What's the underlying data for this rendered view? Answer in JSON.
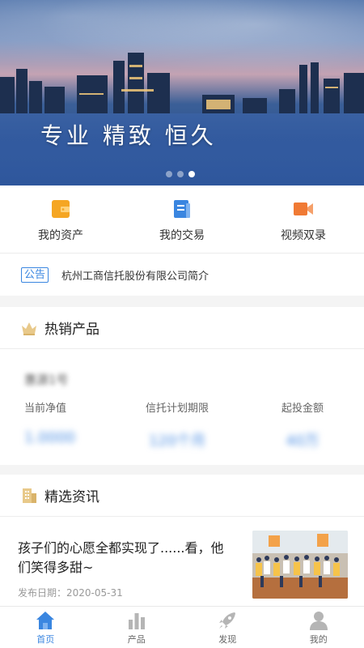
{
  "banner": {
    "slogan": "专业 精致 恒久",
    "slides_total": 3,
    "active_slide": 3
  },
  "quick_menu": [
    {
      "label": "我的资产",
      "icon": "wallet-icon",
      "color": "#f5a623"
    },
    {
      "label": "我的交易",
      "icon": "document-icon",
      "color": "#3a86e0"
    },
    {
      "label": "视频双录",
      "icon": "video-camera-icon",
      "color": "#f07a34"
    }
  ],
  "notice": {
    "tag": "公告",
    "text": "杭州工商信托股份有限公司简介"
  },
  "hot_products": {
    "title": "热销产品",
    "product_name": "惠源1号",
    "metrics": [
      {
        "label": "当前净值",
        "value": "1.0000"
      },
      {
        "label": "信托计划期限",
        "value": "120个月"
      },
      {
        "label": "起投金额",
        "value": "40万"
      }
    ]
  },
  "news": {
    "title": "精选资讯",
    "item_title": "孩子们的心愿全都实现了......看，他们笑得多甜~",
    "date": "发布日期：2020-05-31"
  },
  "tabbar": [
    {
      "label": "首页",
      "icon": "home-icon",
      "active": true
    },
    {
      "label": "产品",
      "icon": "bar-chart-icon",
      "active": false
    },
    {
      "label": "发现",
      "icon": "rocket-icon",
      "active": false
    },
    {
      "label": "我的",
      "icon": "user-icon",
      "active": false
    }
  ],
  "colors": {
    "accent": "#3a86e0",
    "inactive_tab": "#b5b5b5"
  }
}
